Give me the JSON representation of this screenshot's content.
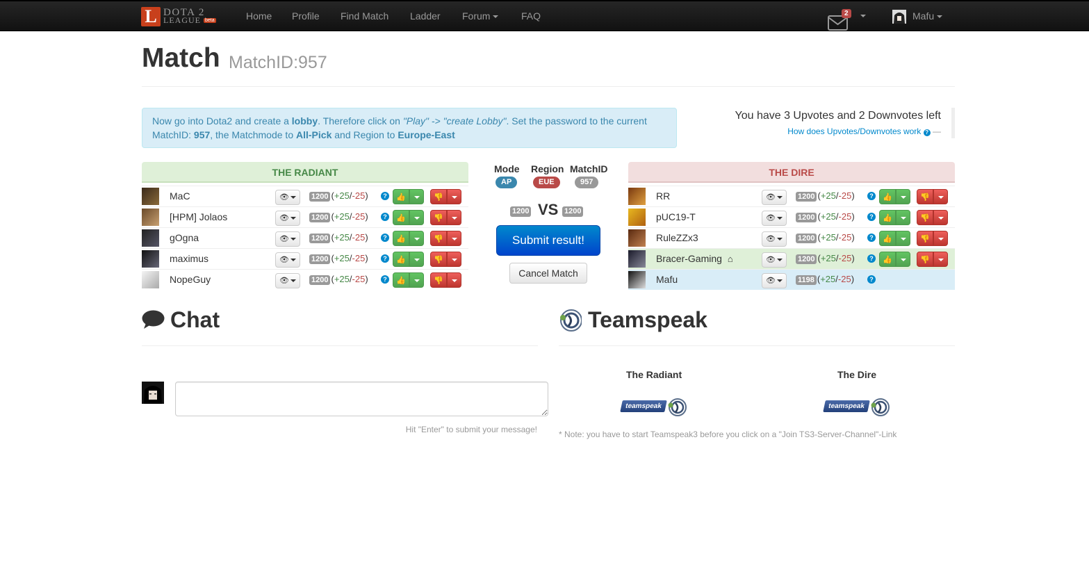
{
  "nav": {
    "brand_line1": "DOTA 2",
    "brand_line2": "LEAGUE",
    "brand_badge": "beta",
    "brand_letter": "L",
    "items": [
      "Home",
      "Profile",
      "Find Match",
      "Ladder",
      "Forum",
      "FAQ"
    ],
    "mail_count": "2",
    "user_name": "Mafu"
  },
  "header": {
    "title": "Match",
    "subtitle": "MatchID:957"
  },
  "alert": {
    "t1": "Now go into Dota2 and create a ",
    "b1": "lobby",
    "t2": ". Therefore click on ",
    "i1": "\"Play\" -> \"create Lobby\"",
    "t3": ". Set the password to the current MatchID: ",
    "b2": "957",
    "t4": ", the Matchmode to ",
    "b3": "All-Pick",
    "t5": " and Region to ",
    "b4": "Europe-East"
  },
  "votes": {
    "line": "You have 3 Upvotes and 2 Downvotes left",
    "link": "How does Upvotes/Downvotes work",
    "dash": "—"
  },
  "radiant": {
    "title": "THE RADIANT",
    "players": [
      {
        "name": "MaC",
        "elo": "1200",
        "plus": "+25",
        "minus": "-25"
      },
      {
        "name": "[HPM] Jolaos",
        "elo": "1200",
        "plus": "+25",
        "minus": "-25"
      },
      {
        "name": "gOgna",
        "elo": "1200",
        "plus": "+25",
        "minus": "-25"
      },
      {
        "name": "maximus",
        "elo": "1200",
        "plus": "+25",
        "minus": "-25"
      },
      {
        "name": "NopeGuy",
        "elo": "1200",
        "plus": "+25",
        "minus": "-25"
      }
    ]
  },
  "dire": {
    "title": "THE DIRE",
    "players": [
      {
        "name": "RR",
        "elo": "1200",
        "plus": "+25",
        "minus": "-25"
      },
      {
        "name": "pUC19-T",
        "elo": "1200",
        "plus": "+25",
        "minus": "-25"
      },
      {
        "name": "RuleZZx3",
        "elo": "1200",
        "plus": "+25",
        "minus": "-25"
      },
      {
        "name": "Bracer-Gaming",
        "elo": "1200",
        "plus": "+25",
        "minus": "-25"
      },
      {
        "name": "Mafu",
        "elo": "1198",
        "plus": "+25",
        "minus": "-25"
      }
    ]
  },
  "middle": {
    "mode_label": "Mode",
    "mode_value": "AP",
    "region_label": "Region",
    "region_value": "EUE",
    "matchid_label": "MatchID",
    "matchid_value": "957",
    "radiant_avg": "1200",
    "vs": "VS",
    "dire_avg": "1200",
    "submit": "Submit result!",
    "cancel": "Cancel Match"
  },
  "chat": {
    "title": "Chat",
    "input_value": "",
    "hint": "Hit \"Enter\" to submit your message!"
  },
  "teamspeak": {
    "title": "Teamspeak",
    "radiant_label": "The Radiant",
    "dire_label": "The Dire",
    "logo_word": "teamspeak",
    "note": "* Note: you have to start Teamspeak3 before you click on a \"Join TS3-Server-Channel\"-Link"
  },
  "colors": {
    "navbar": "#1b1b1b",
    "radiant": "#468847",
    "dire": "#b94a48",
    "primary": "#0088cc",
    "info_bg": "#d9edf7"
  }
}
